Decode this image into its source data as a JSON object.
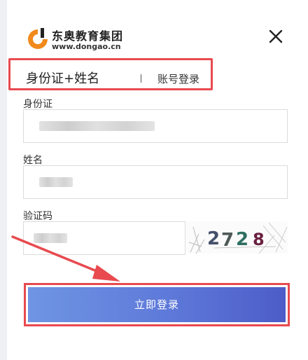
{
  "brand": {
    "name": "东奥教育集团",
    "url": "www.dongao.cn"
  },
  "tabs": {
    "active": "身份证+姓名",
    "other": "账号登录"
  },
  "form": {
    "id_label": "身份证",
    "name_label": "姓名",
    "captcha_label": "验证码",
    "captcha_chars": [
      "2",
      "7",
      "2",
      "8"
    ]
  },
  "login_button": "立即登录",
  "colors": {
    "highlight": "#e84a4f",
    "button_start": "#6f95e3",
    "button_end": "#4d5cc8"
  },
  "icons": {
    "close": "close-icon",
    "logo": "dongao-logo-icon",
    "annotation": "red-arrow-icon"
  }
}
